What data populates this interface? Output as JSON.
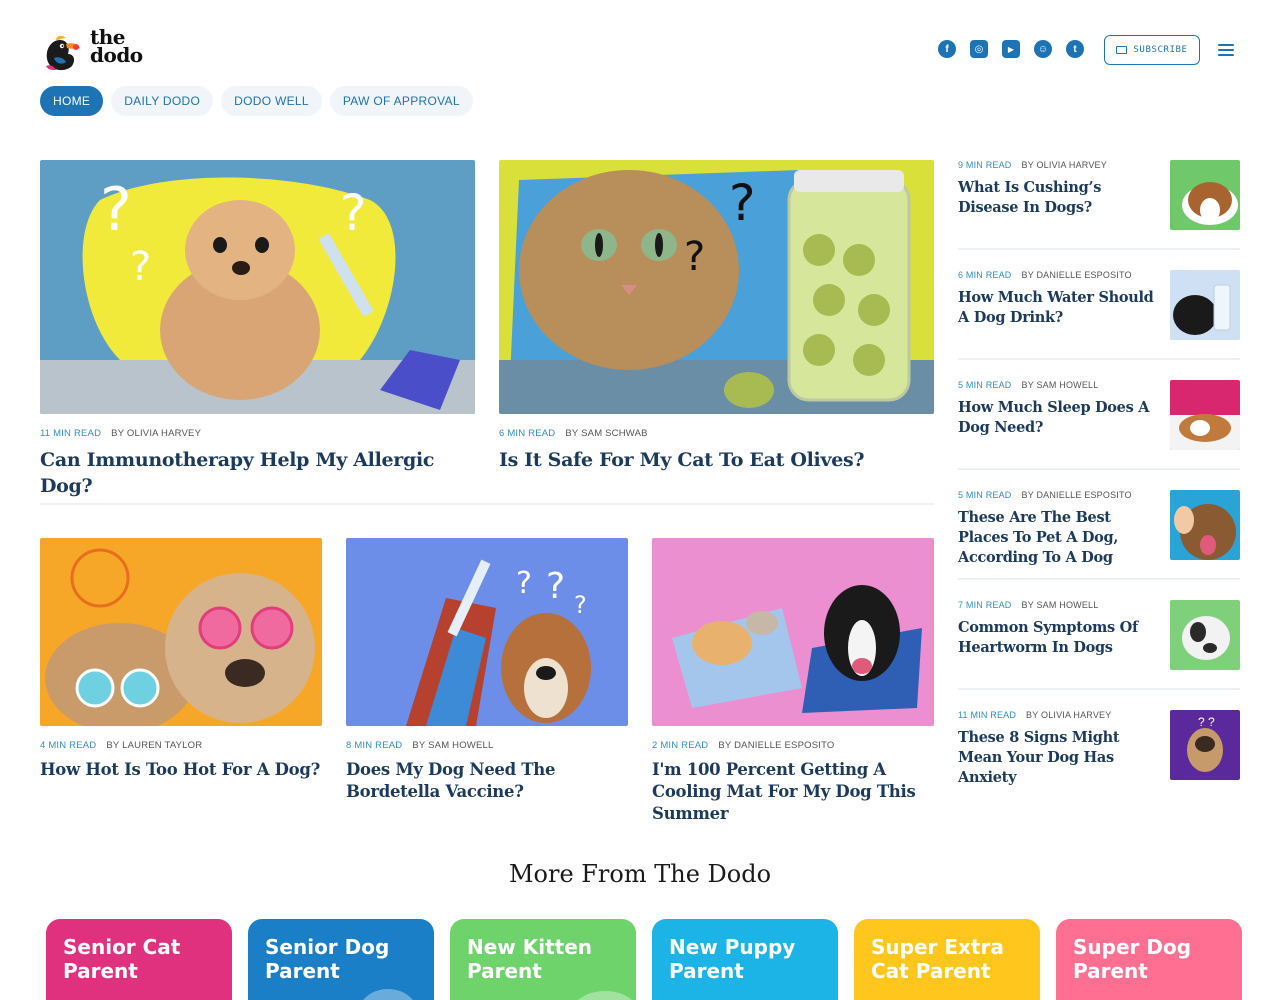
{
  "brand": {
    "line1": "the",
    "line2": "dodo"
  },
  "header": {
    "social": [
      {
        "name": "facebook-icon",
        "glyph": "f"
      },
      {
        "name": "instagram-icon",
        "glyph": "◎"
      },
      {
        "name": "youtube-icon",
        "glyph": "▶"
      },
      {
        "name": "snapchat-icon",
        "glyph": "☺"
      },
      {
        "name": "twitter-icon",
        "glyph": "t"
      }
    ],
    "subscribe_label": "SUBSCRIBE"
  },
  "nav": [
    {
      "label": "HOME",
      "active": true
    },
    {
      "label": "DAILY DODO",
      "active": false
    },
    {
      "label": "DODO WELL",
      "active": false
    },
    {
      "label": "PAW OF APPROVAL",
      "active": false
    }
  ],
  "features": [
    {
      "mins": "11 MIN READ",
      "author": "BY OLIVIA HARVEY",
      "title": "Can Immunotherapy Help My Allergic Dog?"
    },
    {
      "mins": "6 MIN READ",
      "author": "BY SAM SCHWAB",
      "title": "Is It Safe For My Cat To Eat Olives?"
    }
  ],
  "cards": [
    {
      "mins": "4 MIN READ",
      "author": "BY LAUREN TAYLOR",
      "title": "How Hot Is Too Hot For A Dog?"
    },
    {
      "mins": "8 MIN READ",
      "author": "BY SAM HOWELL",
      "title": "Does My Dog Need The Bordetella Vaccine?"
    },
    {
      "mins": "2 MIN READ",
      "author": "BY DANIELLE ESPOSITO",
      "title": "I'm 100 Percent Getting A Cooling Mat For My Dog This Summer"
    }
  ],
  "sidebar": [
    {
      "mins": "9 MIN READ",
      "author": "BY OLIVIA HARVEY",
      "title": "What Is Cushing’s Disease In Dogs?"
    },
    {
      "mins": "6 MIN READ",
      "author": "BY DANIELLE ESPOSITO",
      "title": "How Much Water Should A Dog Drink?"
    },
    {
      "mins": "5 MIN READ",
      "author": "BY SAM HOWELL",
      "title": "How Much Sleep Does A Dog Need?"
    },
    {
      "mins": "5 MIN READ",
      "author": "BY DANIELLE ESPOSITO",
      "title": "These Are The Best Places To Pet A Dog, According To A Dog"
    },
    {
      "mins": "7 MIN READ",
      "author": "BY SAM HOWELL",
      "title": "Common Symptoms Of Heartworm In Dogs"
    },
    {
      "mins": "11 MIN READ",
      "author": "BY OLIVIA HARVEY",
      "title": "These 8 Signs Might Mean Your Dog Has Anxiety"
    }
  ],
  "more": {
    "heading": "More From The Dodo",
    "tiles": [
      {
        "label": "Senior Cat Parent",
        "color": "#e0317f"
      },
      {
        "label": "Senior Dog Parent",
        "color": "#1a7fc6"
      },
      {
        "label": "New Kitten Parent",
        "color": "#6fd36c"
      },
      {
        "label": "New Puppy Parent",
        "color": "#1cb3e6"
      },
      {
        "label": "Super Extra Cat Parent",
        "color": "#ffc61e"
      },
      {
        "label": "Super Dog Parent",
        "color": "#ff6f91"
      }
    ]
  }
}
